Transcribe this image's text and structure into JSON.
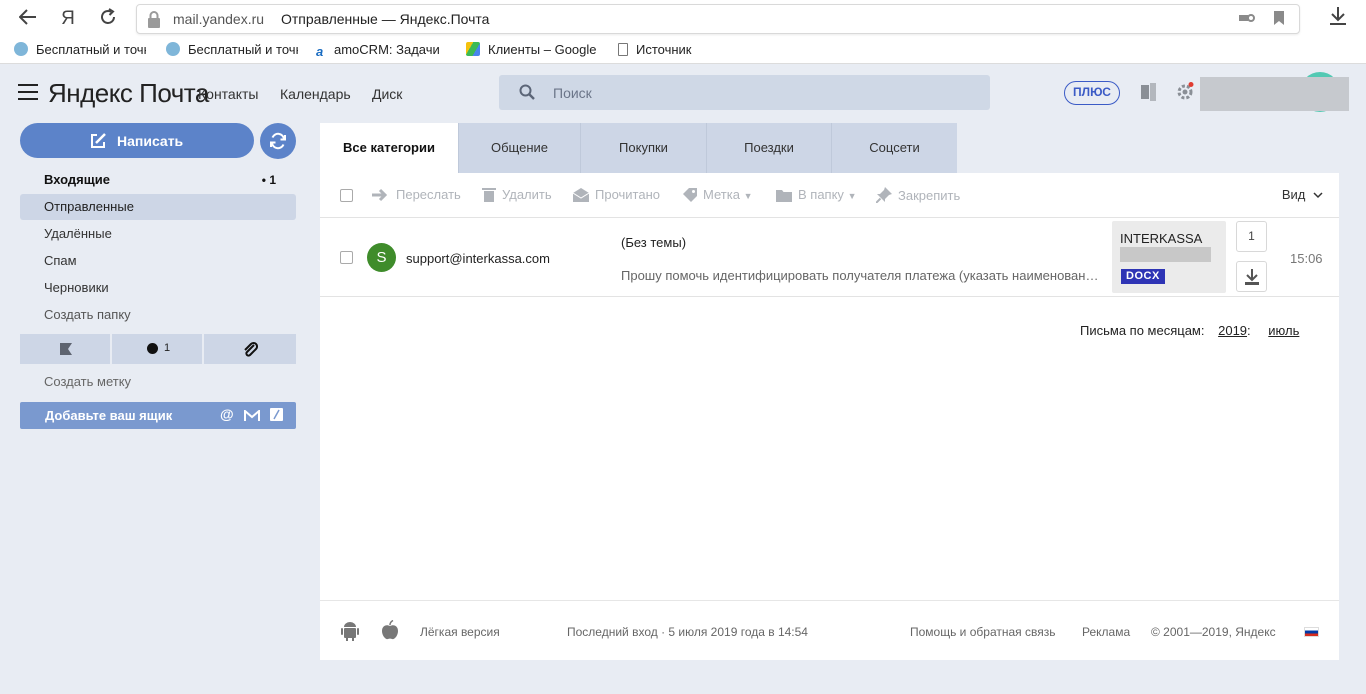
{
  "browser": {
    "domain": "mail.yandex.ru",
    "title": "Отправленные — Яндекс.Почта",
    "yandex_glyph": "Я"
  },
  "bookmarks": [
    {
      "label": "Бесплатный и точн",
      "icon": "globe-icon"
    },
    {
      "label": "Бесплатный и точн",
      "icon": "globe-icon"
    },
    {
      "label": "amoCRM: Задачи",
      "icon": "amocrm-icon"
    },
    {
      "label": "Клиенты – Google",
      "icon": "google-drive-icon"
    },
    {
      "label": "Источник",
      "icon": "page-icon"
    }
  ],
  "header": {
    "logo_yandex": "Яндекс",
    "logo_service": "Почта",
    "nav": [
      "Контакты",
      "Календарь",
      "Диск"
    ],
    "search_placeholder": "Поиск",
    "plus_label": "ПЛЮС"
  },
  "sidebar": {
    "compose_label": "Написать",
    "folders": [
      {
        "label": "Входящие",
        "count": "• 1",
        "bold": true,
        "active": false
      },
      {
        "label": "Отправленные",
        "count": "",
        "bold": false,
        "active": true
      },
      {
        "label": "Удалённые",
        "count": "",
        "bold": false,
        "active": false
      },
      {
        "label": "Спам",
        "count": "",
        "bold": false,
        "active": false
      },
      {
        "label": "Черновики",
        "count": "",
        "bold": false,
        "active": false
      },
      {
        "label": "Создать папку",
        "count": "",
        "bold": false,
        "active": false
      }
    ],
    "unread_count": "1",
    "create_label": "Создать метку",
    "add_mailbox": "Добавьте ваш ящик"
  },
  "tabs": [
    {
      "label": "Все категории",
      "active": true
    },
    {
      "label": "Общение",
      "active": false
    },
    {
      "label": "Покупки",
      "active": false
    },
    {
      "label": "Поездки",
      "active": false
    },
    {
      "label": "Соцсети",
      "active": false
    }
  ],
  "toolbar": {
    "forward": "Переслать",
    "delete": "Удалить",
    "read": "Прочитано",
    "label": "Метка",
    "to_folder": "В папку",
    "pin": "Закрепить",
    "view": "Вид"
  },
  "messages": [
    {
      "avatar_letter": "S",
      "sender": "support@interkassa.com",
      "subject": "(Без темы)",
      "snippet": "Прошу помочь идентифицировать получателя платежа (указать наименовани...",
      "attachment_name": "INTERKASSA",
      "attachment_type": "DOCX",
      "attachment_count": "1",
      "time": "15:06"
    }
  ],
  "months": {
    "label": "Письма по месяцам:",
    "year": "2019",
    "month": "июль"
  },
  "footer": {
    "light_version": "Лёгкая версия",
    "last_login": "Последний вход · 5 июля 2019 года в 14:54",
    "help": "Помощь и обратная связь",
    "ads": "Реклама",
    "copyright": "© 2001—2019, Яндекс"
  },
  "colors": {
    "accent": "#5c83c9",
    "background": "#e8ecf3",
    "avatar": "#3f8c2b",
    "docx_badge": "#2e34b5"
  }
}
